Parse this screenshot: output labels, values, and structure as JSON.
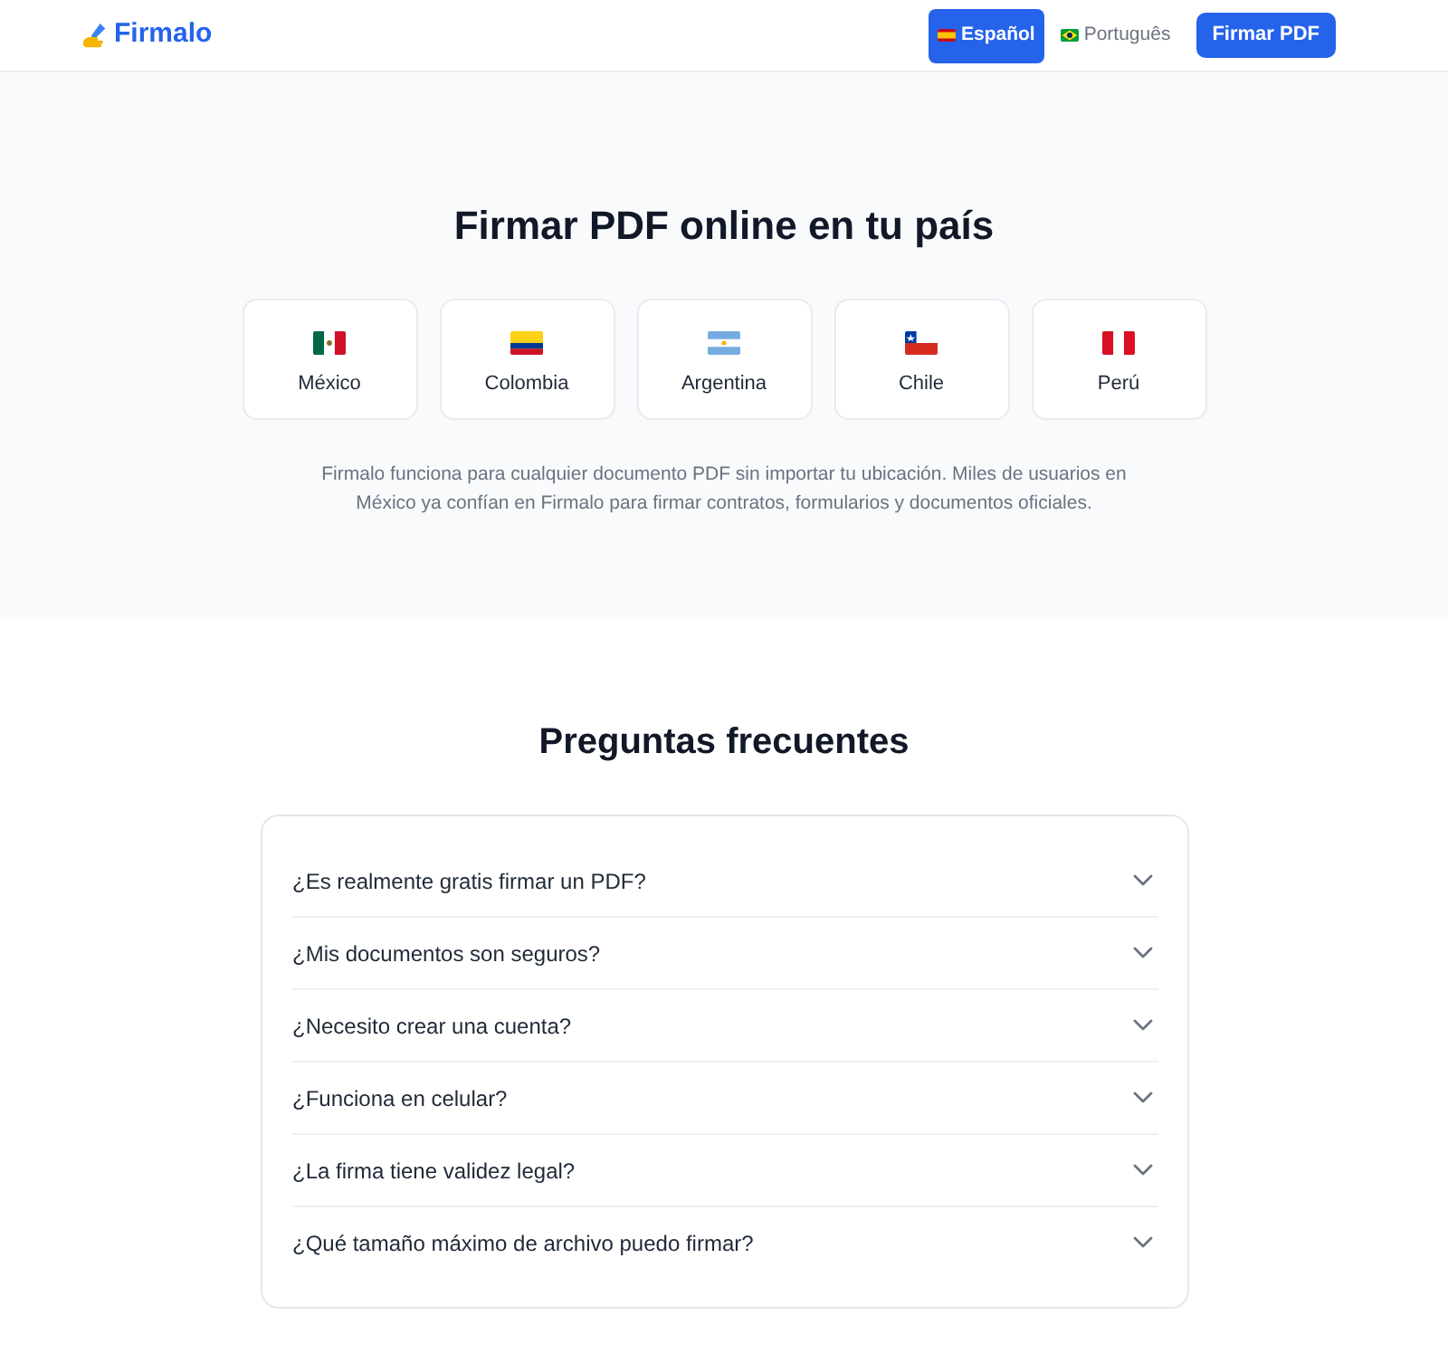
{
  "header": {
    "logo": "Firmalo",
    "languages": [
      {
        "label": "Español",
        "kind": "spain",
        "selected": true
      },
      {
        "label": "Português",
        "kind": "brazil",
        "selected": false
      }
    ],
    "cta_button": "Firmar PDF"
  },
  "countries_section": {
    "title": "Firmar PDF online en tu país",
    "countries": [
      {
        "name": "México",
        "kind": "mexico"
      },
      {
        "name": "Colombia",
        "kind": "colombia"
      },
      {
        "name": "Argentina",
        "kind": "argentina"
      },
      {
        "name": "Chile",
        "kind": "chile"
      },
      {
        "name": "Perú",
        "kind": "peru"
      }
    ],
    "description": "Firmalo funciona para cualquier documento PDF sin importar tu ubicación. Miles de usuarios en México ya confían en Firmalo para firmar contratos, formularios y documentos oficiales."
  },
  "faq_section": {
    "title": "Preguntas frecuentes",
    "items": [
      {
        "question": "¿Es realmente gratis firmar un PDF?",
        "expanded": false
      },
      {
        "question": "¿Mis documentos son seguros?",
        "expanded": false
      },
      {
        "question": "¿Necesito crear una cuenta?",
        "expanded": false
      },
      {
        "question": "¿Funciona en celular?",
        "expanded": false
      },
      {
        "question": "¿La firma tiene validez legal?",
        "expanded": false
      },
      {
        "question": "¿Qué tamaño máximo de archivo puedo firmar?",
        "expanded": false
      }
    ]
  }
}
